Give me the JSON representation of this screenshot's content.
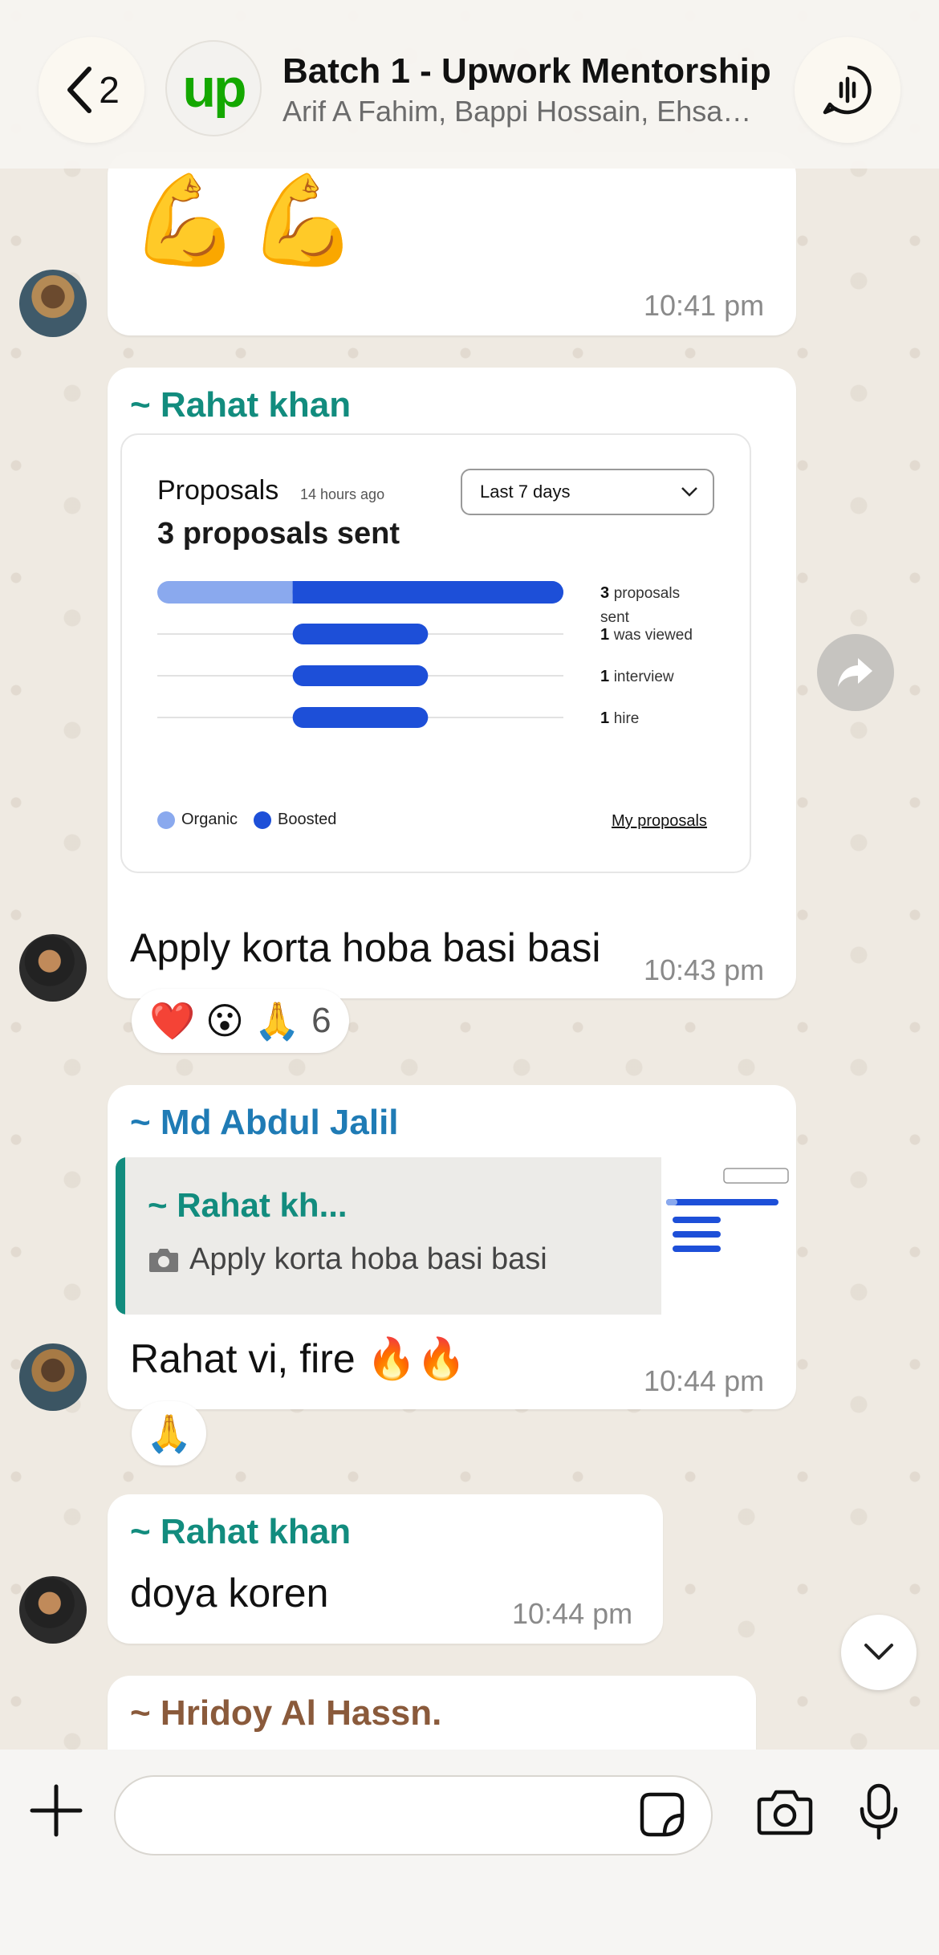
{
  "header": {
    "back_count": "2",
    "title": "Batch 1 - Upwork Mentorship",
    "subtitle": "Arif A Fahim, Bappi Hossain, Ehsa…",
    "group_logo_text": "up"
  },
  "colors": {
    "background": "#efeae2",
    "bubble": "#ffffff",
    "rahat_name": "#128c7e",
    "abdul_name": "#1f7bb5",
    "hridoy_name": "#8a5a3b",
    "upwork_green": "#14a800",
    "organic": "#8aa9ee",
    "boosted": "#1d4fd8"
  },
  "messages": [
    {
      "id": "msg1",
      "emoji": "💪💪",
      "time": "10:41 pm"
    },
    {
      "id": "msg2",
      "sender": "~ Rahat khan",
      "text": "Apply korta hoba basi basi",
      "time": "10:43 pm",
      "reactions": {
        "emojis": "❤️ 😮 🙏",
        "count": "6"
      },
      "card": {
        "title": "Proposals",
        "ago": "14 hours ago",
        "summary": "3 proposals sent",
        "dropdown": "Last 7 days",
        "link": "My proposals"
      }
    },
    {
      "id": "msg3",
      "sender": "~ Md Abdul Jalil",
      "quote_sender": "~ Rahat kh...",
      "quote_text": "Apply korta hoba basi basi",
      "text": "Rahat vi,  fire 🔥🔥",
      "time": "10:44 pm",
      "reactions": {
        "emojis": "🙏"
      }
    },
    {
      "id": "msg4",
      "sender": "~ Rahat khan",
      "text": "doya koren",
      "time": "10:44 pm"
    },
    {
      "id": "msg5",
      "sender": "~ Hridoy Al Hassn."
    }
  ],
  "chart_data": {
    "type": "bar",
    "categories": [
      "proposals sent",
      "was viewed",
      "interview",
      "hire"
    ],
    "series": [
      {
        "name": "Organic",
        "values": [
          1,
          0,
          0,
          0
        ]
      },
      {
        "name": "Boosted",
        "values": [
          2,
          1,
          1,
          1
        ]
      }
    ],
    "row_labels": [
      {
        "count": "3",
        "label": "proposals sent"
      },
      {
        "count": "1",
        "label": "was viewed"
      },
      {
        "count": "1",
        "label": "interview"
      },
      {
        "count": "1",
        "label": "hire"
      }
    ],
    "legend": [
      "Organic",
      "Boosted"
    ],
    "legend_position": "bottom-left"
  },
  "composer": {
    "input_placeholder": ""
  }
}
